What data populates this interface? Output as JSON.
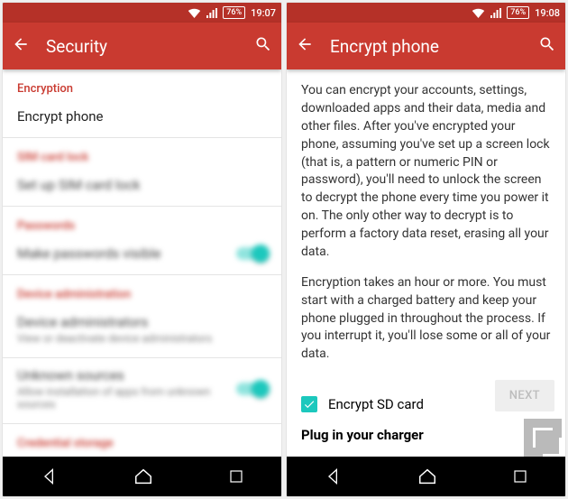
{
  "left": {
    "status": {
      "battery": "76%",
      "time": "19:07"
    },
    "title": "Security",
    "sections": {
      "encryption_header": "Encryption",
      "encrypt_phone": "Encrypt phone",
      "sim_header": "SIM card lock",
      "sim_item": "Set up SIM card lock",
      "passwords_header": "Passwords",
      "passwords_item": "Make passwords visible",
      "device_admin_header": "Device administration",
      "device_admin_item": "Device administrators",
      "device_admin_sub": "View or deactivate device administrators",
      "unknown_item": "Unknown sources",
      "unknown_sub": "Allow installation of apps from unknown sources",
      "cred_header": "Credential storage"
    }
  },
  "right": {
    "status": {
      "battery": "76%",
      "time": "19:08"
    },
    "title": "Encrypt phone",
    "para1": "You can encrypt your accounts, settings, downloaded apps and their data, media and other files. After you've encrypted your phone, assuming you've set up a screen lock (that is, a pattern or numeric PIN or password), you'll need to unlock the screen to decrypt the phone every time you power it on. The only other way to decrypt is to perform a factory data reset, erasing all your data.",
    "para2": "Encryption takes an hour or more. You must start with a charged battery and keep your phone plugged in throughout the process. If you interrupt it, you'll lose some or all of your data.",
    "checkbox_label": "Encrypt SD card",
    "plug_note": "Plug in your charger",
    "next": "NEXT"
  }
}
